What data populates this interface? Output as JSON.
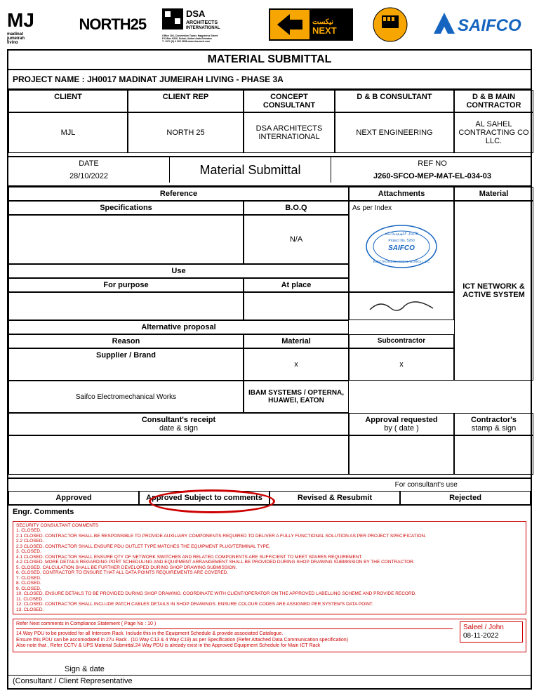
{
  "header": {
    "title": "MATERIAL SUBMITTAL",
    "project_label": "PROJECT NAME  : JH0017 MADINAT JUMEIRAH LIVING - PHASE 3A"
  },
  "parties": {
    "client_h": "CLIENT",
    "clientrep_h": "CLIENT REP",
    "concept_h": "CONCEPT CONSULTANT",
    "db_h": "D & B CONSULTANT",
    "dbmain_h": "D & B MAIN CONTRACTOR",
    "client": "MJL",
    "clientrep": "NORTH 25",
    "concept": "DSA ARCHITECTS INTERNATIONAL",
    "db": "NEXT ENGINEERING",
    "dbmain": "AL SAHEL CONTRACTING CO LLC."
  },
  "meta": {
    "date_h": "DATE",
    "date": "28/10/2022",
    "midtitle": "Material Submittal",
    "ref_h": "REF NO",
    "ref": "J260-SFCO-MEP-MAT-EL-034-03"
  },
  "grid": {
    "reference_h": "Reference",
    "attachments_h": "Attachments",
    "material_h": "Material",
    "spec_h": "Specifications",
    "boq_h": "B.O.Q",
    "boq_val": "N/A",
    "attach_val": "As per  Index",
    "material_val": "ICT NETWORK & ACTIVE SYSTEM",
    "use_h": "Use",
    "forpurpose_h": "For purpose",
    "atplace_h": "At place",
    "alt_h": "Alternative proposal",
    "reason_h": "Reason",
    "reason_val": "x",
    "mat_h": "Material",
    "mat_val": "x",
    "sub_h": "Subcontractor",
    "sub_val": "Saifco Electromechanical Works",
    "supplier_h": "Supplier / Brand",
    "supplier_val": "IBAM SYSTEMS / OPTERNA, HUAWEI, EATON",
    "receipt_h": "Consultant's receipt",
    "receipt_sub": "date & sign",
    "approval_h": "Approval requested",
    "approval_sub": "by ( date )",
    "contractor_h": "Contractor's",
    "contractor_sub": "stamp & sign"
  },
  "consult": {
    "for_use": "For consultant's use",
    "approved": "Approved",
    "approved_stc": "Approved Subject to comments",
    "revised": "Revised & Resubmit",
    "rejected": "Rejected",
    "comments_h": "Engr.  Comments"
  },
  "comments": {
    "l0": "SECURITY CONSULTANT COMMENTS",
    "l1": "1. CLOSED.",
    "l2": "2.1 CLOSED. CONTRACTOR SHALL BE RESPONSIBLE TO PROVIDE AUXILIARY COMPONENTS REQUIRED TO DELIVER A FULLY FUNCTIONAL SOLUTION AS PER PROJECT SPECIFICATION.",
    "l3": "2.2 CLOSED.",
    "l4": "2.3 CLOSED. CONTRACTOR SHALL ENSURE PDU OUTLET TYPE MATCHES THE EQUIPMENT PLUG/TERMINAL TYPE.",
    "l5": "3. CLOSED.",
    "l6": "4.1 CLOSED. CONTRACTOR SHALL ENSURE QTY OF NETWORK SWITCHES AND RELATED COMPONENTS ARE SUFFICIENT TO MEET SPARES REQUIREMENT.",
    "l7": "4.2 CLOSED. MORE DETAILS REGARDING PORT SCHEDULING AND EQUIPMENT ARRANGEMENT SHALL BE PROVIDED DURING SHOP DRAWING SUBMISSION BY THE CONTRACTOR.",
    "l8": "5. CLOSED. CALCULATION SHALL BE FURTHER DEVELOPED DURING SHOP DRAWING SUBMISSION.",
    "l9": "6. CLOSED. CONTRACTOR TO ENSURE THAT ALL DATA POINTS REQUIREMENTS ARE COVERED.",
    "l10": "7. CLOSED.",
    "l11": "8. CLOSED.",
    "l12": "9. CLOSED.",
    "l13": "10. CLOSED. ENSURE DETAILS TO BE PROVIDED DURING SHOP DRAWING. COORDINATE WITH CLIENT/OPERATOR ON THE APPROVED LABELLING SCHEME AND PROVIDE RECORD.",
    "l14": "11. CLOSED.",
    "l15": "12. CLOSED. CONTRACTOR SHALL INCLUDE PATCH CABLES DETAILS IN SHOP DRAWINGS. ENSURE COLOUR CODES ARE ASSIGNED PER SYSTEM'S DATA POINT.",
    "l16": "13. CLOSED."
  },
  "notes": {
    "n0": "Refer Next comments in Compliance Statement ( Page No : 10 )",
    "n1": "14.Way PDU to be provided for all Intercom Rack. Include this in the Equipment Schedule & provide associated Catalogue.",
    "n2": "Ensure this PDU can be accomodated in 27u Rack . (10 Way C13 & 4 Way C19) as per Specification (Refer Attached Data Communication specification)",
    "n3": "Also note that , Refer CCTV & UPS Material Submittal.24 Way PDU is already exist in the Approved Equipment Schedule for Main ICT Rack"
  },
  "signer": {
    "name": "Saleel / John",
    "date": "08-11-2022"
  },
  "footer": {
    "sign_date": "Sign & date",
    "rep": "(Consultant / Client Representative"
  },
  "logos": {
    "mj": "MJ madinat jumeirah living",
    "north25": "NORTH25",
    "dsa": "DSA ARCHITECTS INTERNATIONAL",
    "next": "NEXT",
    "saifco": "SAIFCO"
  }
}
